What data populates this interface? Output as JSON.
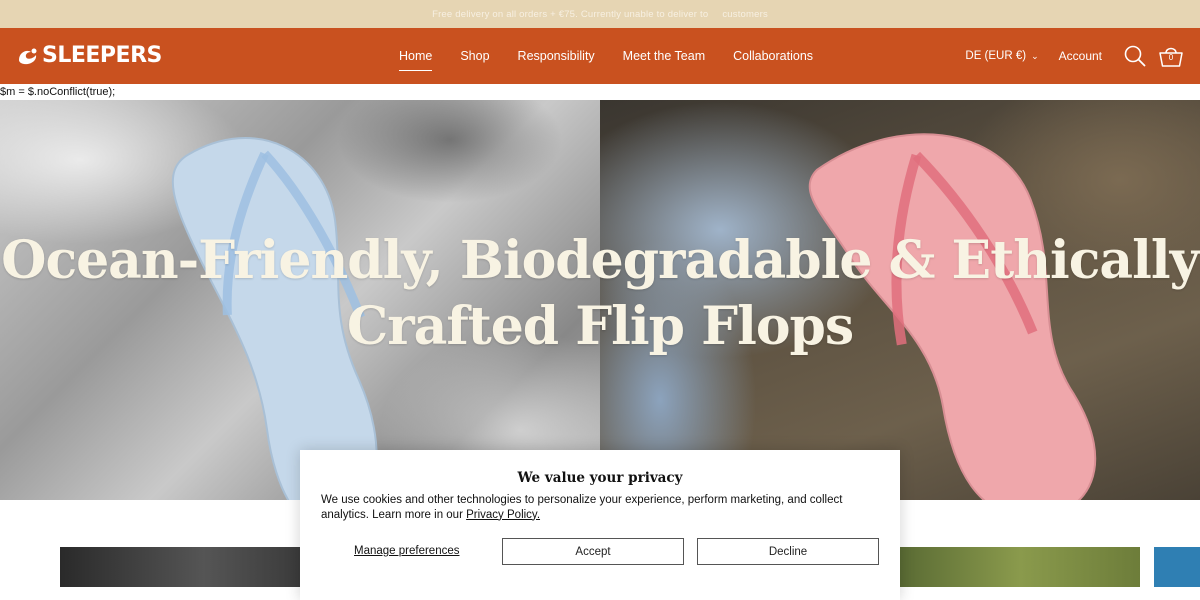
{
  "announcement": {
    "left": "Free delivery on all orders + €75. Currently unable to deliver to",
    "right": "customers"
  },
  "header": {
    "logo_text": "SLEEPERS",
    "nav": [
      "Home",
      "Shop",
      "Responsibility",
      "Meet the Team",
      "Collaborations"
    ],
    "active_nav": "Home",
    "currency": "DE (EUR €)",
    "account": "Account",
    "cart_count": "0",
    "icons": [
      "search-icon",
      "cart-icon",
      "chevron-down-icon"
    ]
  },
  "code_line": "$m = $.noConflict(true);",
  "hero": {
    "title_line1": "Ocean-Friendly, Biodegradable & Ethically",
    "title_line2": "Crafted Flip Flops"
  },
  "cookie": {
    "title": "We value your privacy",
    "body": "We use cookies and other technologies to personalize your experience, perform marketing, and collect analytics. Learn more in our",
    "link": "Privacy Policy.",
    "manage": "Manage preferences",
    "accept": "Accept",
    "decline": "Decline"
  },
  "colors": {
    "announcement_bg": "#e6d5b3",
    "header_bg": "#c9511f",
    "hero_text": "#f8f3e3"
  }
}
